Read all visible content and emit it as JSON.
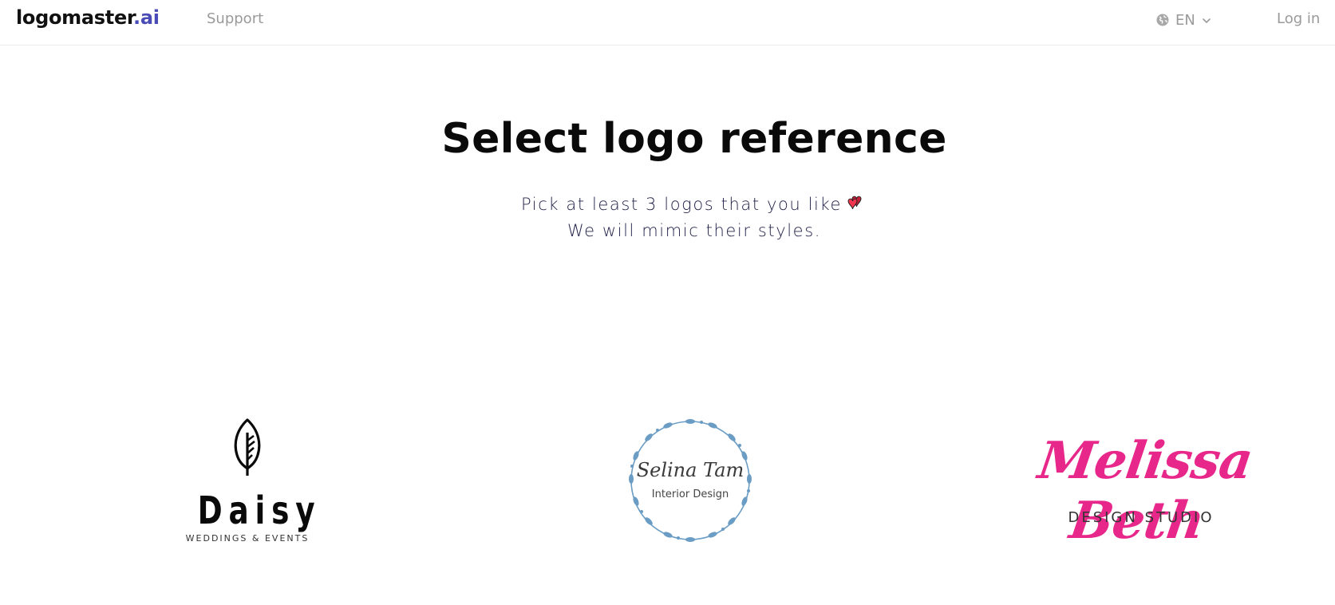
{
  "header": {
    "brand_name": "logomaster",
    "brand_tld": ".ai",
    "support_label": "Support",
    "language_code": "EN",
    "login_label": "Log in"
  },
  "hero": {
    "title": "Select logo reference",
    "subtitle_line1": "Pick at least 3 logos that you like",
    "subtitle_line2": "We will mimic their styles."
  },
  "logos": [
    {
      "name": "Daisy",
      "tagline": "WEDDINGS & EVENTS",
      "color": "#0a0a0a",
      "icon": "leaf-icon"
    },
    {
      "name": "Selina Tam",
      "tagline": "Interior Design",
      "color": "#6a9cc4",
      "icon": "floral-wreath-icon"
    },
    {
      "name": "Melissa Beth",
      "tagline": "DESIGN STUDIO",
      "color": "#e8278a"
    }
  ],
  "colors": {
    "brand_accent": "#4b4bb8",
    "nav_text": "#9a9a9a",
    "subtitle_text": "#23234a",
    "heart": "#e8243c"
  },
  "icons": {
    "language": "globe-icon",
    "language_dropdown": "chevron-down-icon",
    "subtitle_emoji": "two-hearts-icon"
  }
}
